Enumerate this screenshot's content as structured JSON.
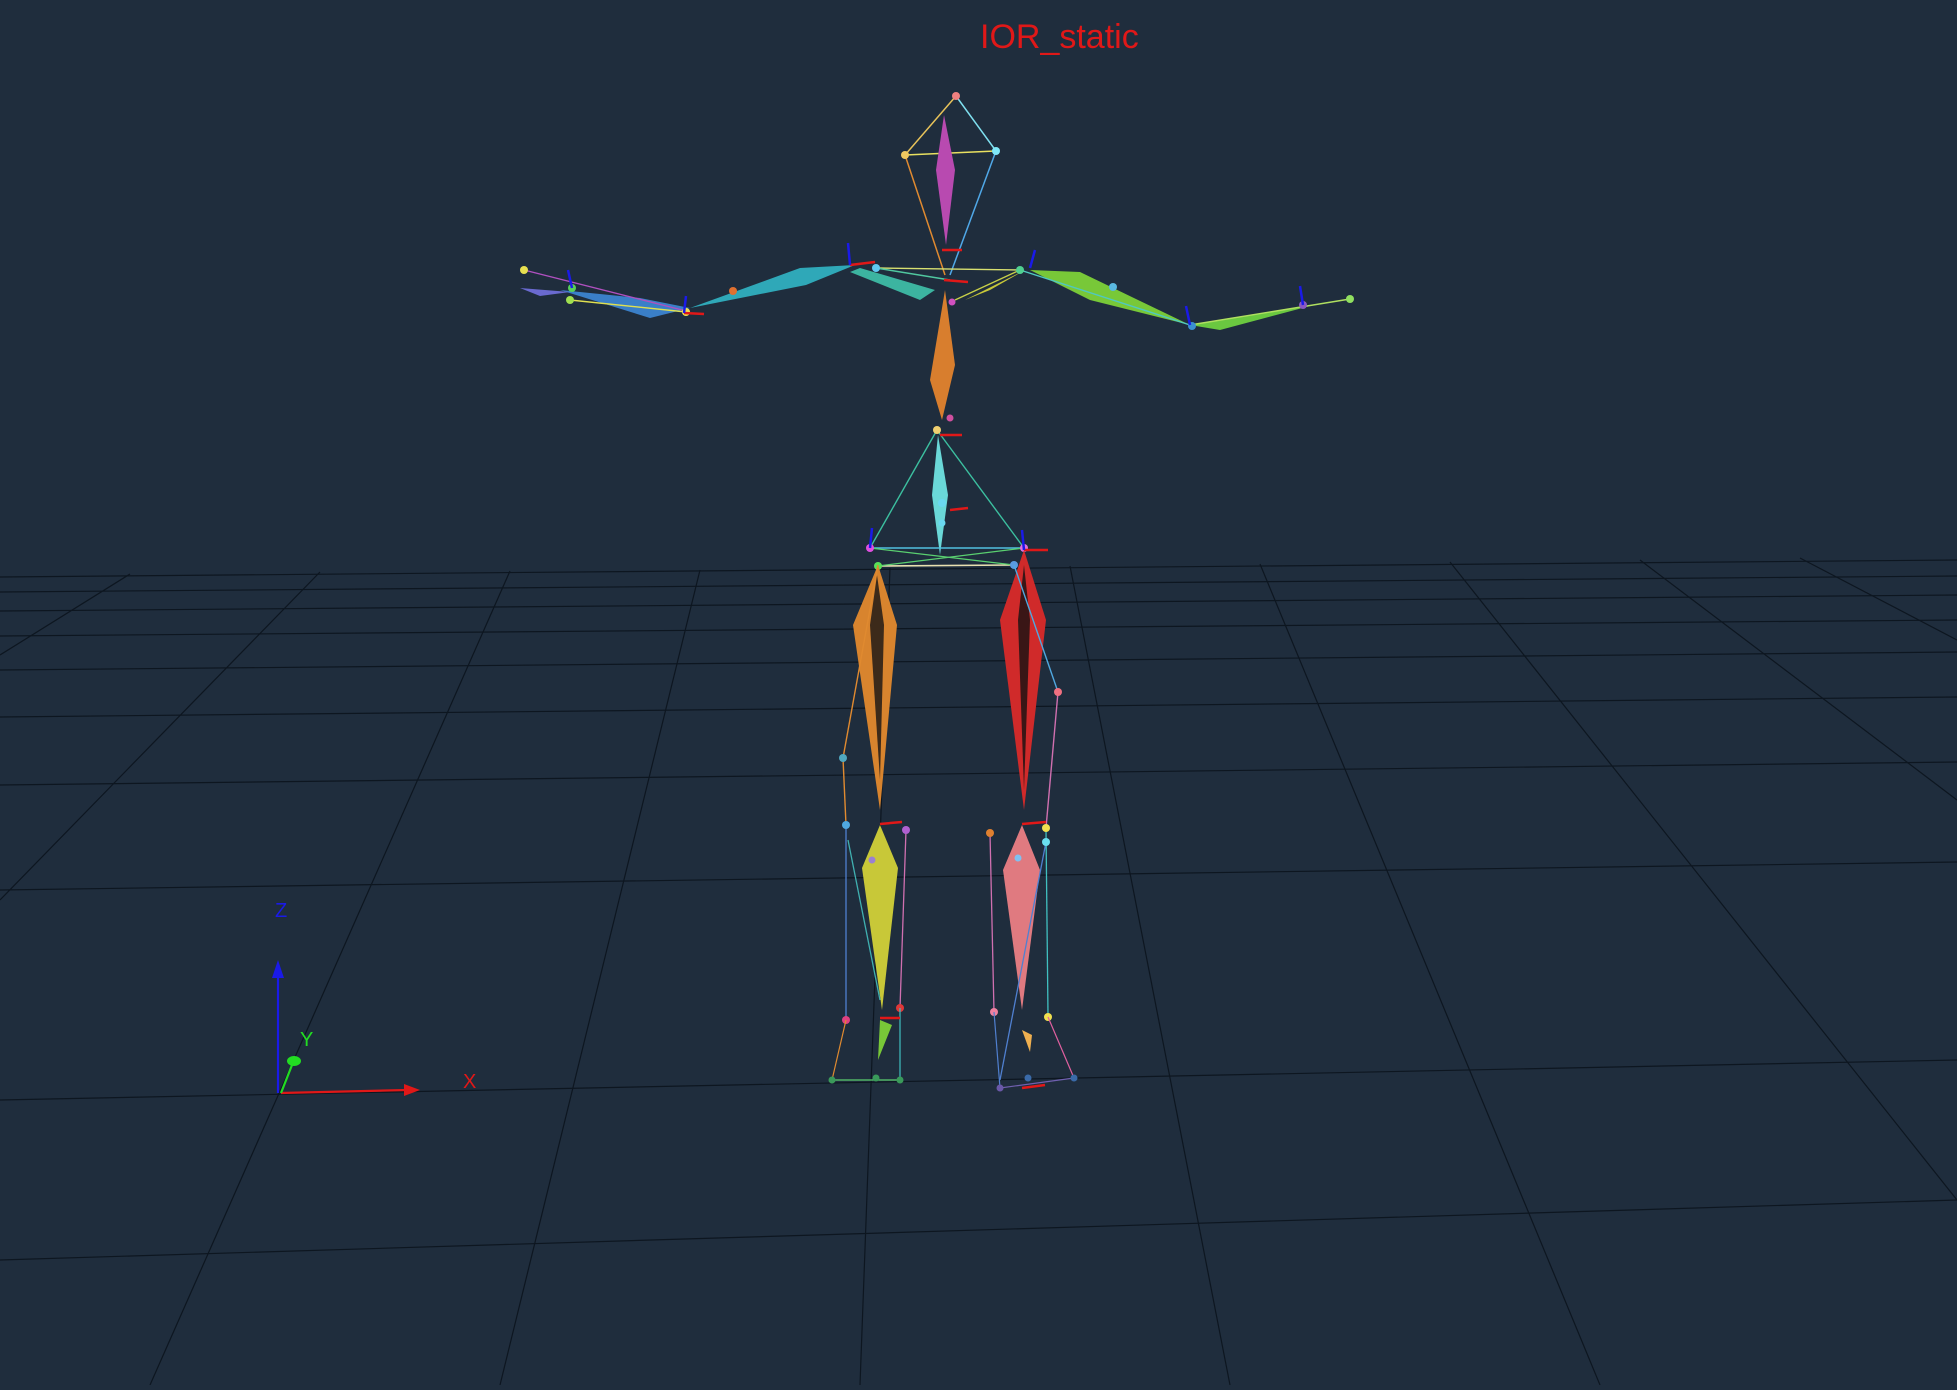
{
  "title": "IOR_static",
  "axes": {
    "x_label": "X",
    "y_label": "Y",
    "z_label": "Z",
    "x_color": "#e01818",
    "y_color": "#22dd22",
    "z_color": "#1a1ae8"
  },
  "colors": {
    "background": "#1f2d3d",
    "grid": "#0d1620"
  }
}
